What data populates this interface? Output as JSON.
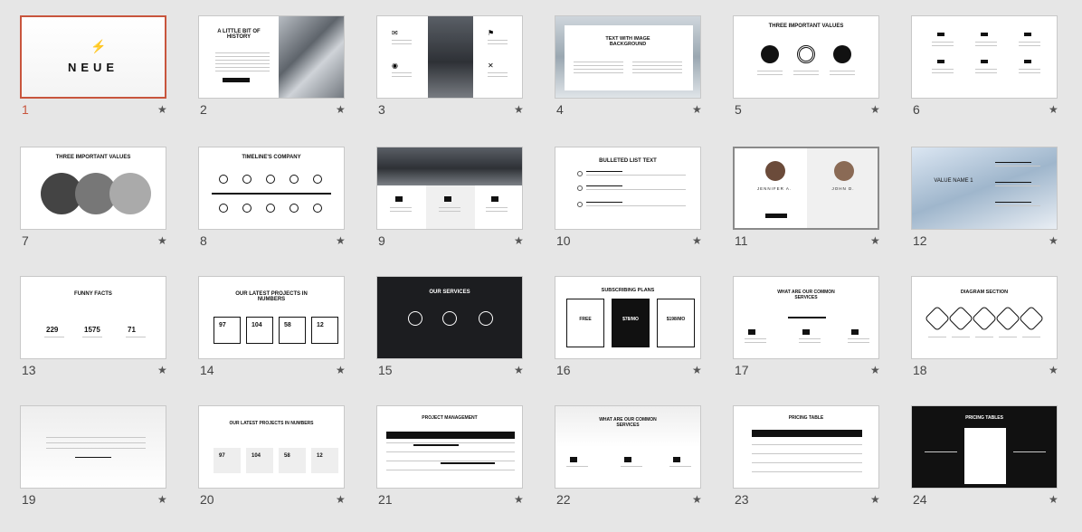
{
  "slides": [
    {
      "n": "1",
      "title": "NEUE"
    },
    {
      "n": "2",
      "title": "A LITTLE BIT OF HISTORY"
    },
    {
      "n": "3",
      "title": ""
    },
    {
      "n": "4",
      "title": "TEXT WITH IMAGE BACKGROUND"
    },
    {
      "n": "5",
      "title": "THREE IMPORTANT VALUES"
    },
    {
      "n": "6",
      "title": ""
    },
    {
      "n": "7",
      "title": "THREE IMPORTANT VALUES"
    },
    {
      "n": "8",
      "title": "TIMELINE'S COMPANY"
    },
    {
      "n": "9",
      "title": ""
    },
    {
      "n": "10",
      "title": "BULLETED LIST TEXT"
    },
    {
      "n": "11",
      "title": "",
      "names": [
        "JENNIFER A.",
        "JOHN D."
      ]
    },
    {
      "n": "12",
      "title": "VALUE NAME 1"
    },
    {
      "n": "13",
      "title": "FUNNY FACTS",
      "stats": [
        "229",
        "1575",
        "71"
      ]
    },
    {
      "n": "14",
      "title": "OUR LATEST PROJECTS IN NUMBERS",
      "stats": [
        "97",
        "104",
        "58",
        "12"
      ]
    },
    {
      "n": "15",
      "title": "OUR SERVICES"
    },
    {
      "n": "16",
      "title": "SUBSCRIBING PLANS",
      "prices": [
        "FREE",
        "$78/MO",
        "$198/MO"
      ]
    },
    {
      "n": "17",
      "title": "WHAT ARE OUR COMMON SERVICES"
    },
    {
      "n": "18",
      "title": "DIAGRAM SECTION"
    },
    {
      "n": "19",
      "title": ""
    },
    {
      "n": "20",
      "title": "OUR LATEST PROJECTS IN NUMBERS",
      "stats": [
        "97",
        "104",
        "58",
        "12"
      ]
    },
    {
      "n": "21",
      "title": "PROJECT MANAGEMENT"
    },
    {
      "n": "22",
      "title": "WHAT ARE OUR COMMON SERVICES"
    },
    {
      "n": "23",
      "title": "PRICING TABLE"
    },
    {
      "n": "24",
      "title": "PRICING TABLES"
    }
  ],
  "star_glyph": "★",
  "colors": {
    "selected": "#c8553d",
    "background": "#e6e6e6"
  }
}
